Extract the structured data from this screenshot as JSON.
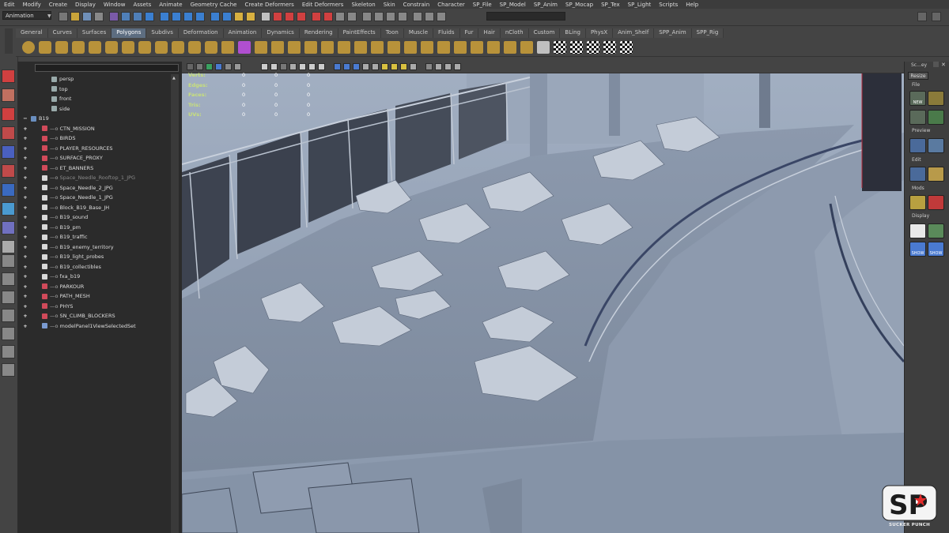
{
  "menubar": [
    "Edit",
    "Modify",
    "Create",
    "Display",
    "Window",
    "Assets",
    "Animate",
    "Geometry Cache",
    "Create Deformers",
    "Edit Deformers",
    "Skeleton",
    "Skin",
    "Constrain",
    "Character",
    "SP_File",
    "SP_Model",
    "SP_Anim",
    "SP_Mocap",
    "SP_Tex",
    "SP_Light",
    "Scripts",
    "Help"
  ],
  "status_line": {
    "mode": "Animation"
  },
  "shelf_tabs": [
    "General",
    "Curves",
    "Surfaces",
    "Polygons",
    "Subdivs",
    "Deformation",
    "Animation",
    "Dynamics",
    "Rendering",
    "PaintEffects",
    "Toon",
    "Muscle",
    "Fluids",
    "Fur",
    "Hair",
    "nCloth",
    "Custom",
    "BLing",
    "PhysX",
    "Anim_Shelf",
    "SPP_Anim",
    "SPP_Rig"
  ],
  "shelf_active": "Polygons",
  "outliner": [
    {
      "label": "persp",
      "icon": "camera-icon",
      "expand": ""
    },
    {
      "label": "top",
      "icon": "camera-icon",
      "expand": ""
    },
    {
      "label": "front",
      "icon": "camera-icon",
      "expand": ""
    },
    {
      "label": "side",
      "icon": "camera-icon",
      "expand": ""
    },
    {
      "label": "B19",
      "icon": "group-icon",
      "expand": "−"
    },
    {
      "label": "CTN_MISSION",
      "icon": "layer-icon",
      "expand": "+"
    },
    {
      "label": "BIRDS",
      "icon": "layer-icon",
      "expand": "+"
    },
    {
      "label": "PLAYER_RESOURCES",
      "icon": "layer-icon",
      "expand": "+"
    },
    {
      "label": "SURFACE_PROXY",
      "icon": "layer-icon",
      "expand": "+"
    },
    {
      "label": "ET_BANNERS",
      "icon": "layer-icon",
      "expand": "+"
    },
    {
      "label": "Space_Needle_Rooftop_1_JPG",
      "icon": "reference-icon",
      "expand": "+",
      "dim": true
    },
    {
      "label": "Space_Needle_2_JPG",
      "icon": "reference-icon",
      "expand": "+"
    },
    {
      "label": "Space_Needle_1_JPG",
      "icon": "reference-icon",
      "expand": "+"
    },
    {
      "label": "Block_B19_Base_JH",
      "icon": "reference-icon",
      "expand": "+"
    },
    {
      "label": "B19_sound",
      "icon": "reference-icon",
      "expand": "+"
    },
    {
      "label": "B19_pm",
      "icon": "reference-icon",
      "expand": "+"
    },
    {
      "label": "B19_traffic",
      "icon": "reference-icon",
      "expand": "+"
    },
    {
      "label": "B19_enemy_territory",
      "icon": "reference-icon",
      "expand": "+"
    },
    {
      "label": "B19_light_probes",
      "icon": "reference-icon",
      "expand": "+"
    },
    {
      "label": "B19_collectibles",
      "icon": "reference-icon",
      "expand": "+"
    },
    {
      "label": "fxa_b19",
      "icon": "reference-icon",
      "expand": "+"
    },
    {
      "label": "PARKOUR",
      "icon": "layer-icon",
      "expand": "+"
    },
    {
      "label": "PATH_MESH",
      "icon": "layer-icon",
      "expand": "+"
    },
    {
      "label": "PHYS",
      "icon": "layer-icon",
      "expand": "+"
    },
    {
      "label": "SN_CLIMB_BLOCKERS",
      "icon": "layer-icon",
      "expand": "+"
    },
    {
      "label": "modelPanel1ViewSelectedSet",
      "icon": "set-icon",
      "expand": "+"
    }
  ],
  "hud": [
    {
      "label": "Verts:",
      "values": [
        "0",
        "0",
        "0"
      ]
    },
    {
      "label": "Edges:",
      "values": [
        "0",
        "0",
        "0"
      ]
    },
    {
      "label": "Faces:",
      "values": [
        "0",
        "0",
        "0"
      ]
    },
    {
      "label": "Tris:",
      "values": [
        "0",
        "0",
        "0"
      ]
    },
    {
      "label": "UVs:",
      "values": [
        "0",
        "0",
        "0"
      ]
    }
  ],
  "right_panel": {
    "title": "Sc...ey",
    "resize": "Resize",
    "sections": [
      "File",
      "Preview",
      "Edit",
      "Mods",
      "Display"
    ],
    "labels": {
      "new": "NEW",
      "show_ma": "SHOW",
      "show": "SHOW",
      "ma": "MA"
    }
  },
  "logo": {
    "text": "SP",
    "subtitle": "SUCKER PUNCH"
  },
  "colors": {
    "viewport": "#8a98ad",
    "hud_label": "#c8e07a",
    "shelf_active": "#5d6d80",
    "logo_red": "#e22b2b"
  }
}
